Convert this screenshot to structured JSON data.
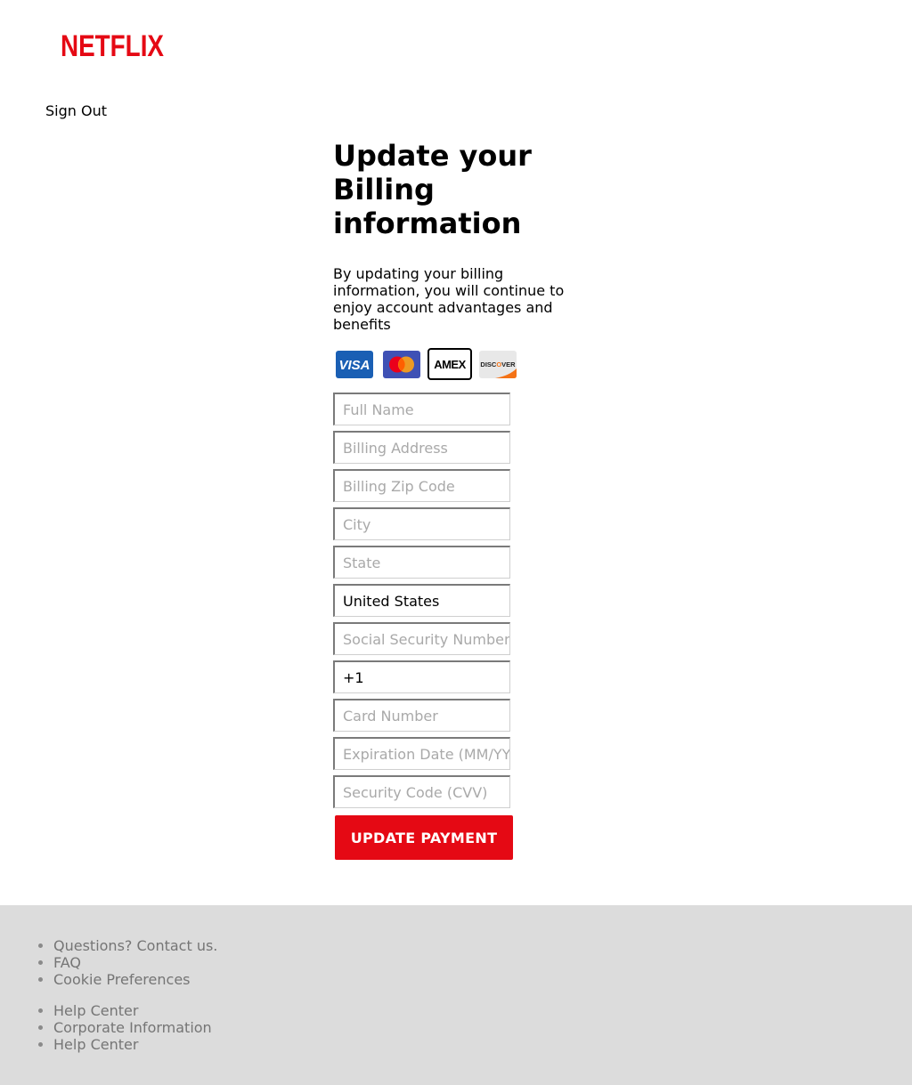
{
  "header": {
    "logo_text": "NETFLIX",
    "brand_color": "#e50914",
    "sign_out": "Sign Out"
  },
  "main": {
    "title": "Update your Billing information",
    "subtitle": "By updating your billing information, you will continue to enjoy account advantages and benefits",
    "cards": [
      {
        "name": "visa-icon",
        "label": "VISA"
      },
      {
        "name": "mastercard-icon",
        "label": ""
      },
      {
        "name": "amex-icon",
        "label": "AMEX"
      },
      {
        "name": "discover-icon",
        "label": "DISCOVER"
      }
    ],
    "fields": {
      "full_name": {
        "placeholder": "Full Name",
        "value": ""
      },
      "billing_address": {
        "placeholder": "Billing Address",
        "value": ""
      },
      "zip": {
        "placeholder": "Billing Zip Code",
        "value": ""
      },
      "city": {
        "placeholder": "City",
        "value": ""
      },
      "state": {
        "placeholder": "State",
        "value": ""
      },
      "country": {
        "placeholder": "",
        "value": "United States"
      },
      "ssn": {
        "placeholder": "Social Security Number",
        "value": ""
      },
      "phone": {
        "placeholder": "",
        "value": "+1"
      },
      "card_number": {
        "placeholder": "Card Number",
        "value": ""
      },
      "expiration": {
        "placeholder": "Expiration Date (MM/YY)",
        "value": ""
      },
      "cvv": {
        "placeholder": "Security Code (CVV)",
        "value": ""
      }
    },
    "submit_label": "UPDATE PAYMENT"
  },
  "footer": {
    "group1": [
      "Questions? Contact us.",
      "FAQ",
      "Cookie Preferences"
    ],
    "group2": [
      "Help Center",
      "Corporate Information",
      "Help Center"
    ]
  }
}
